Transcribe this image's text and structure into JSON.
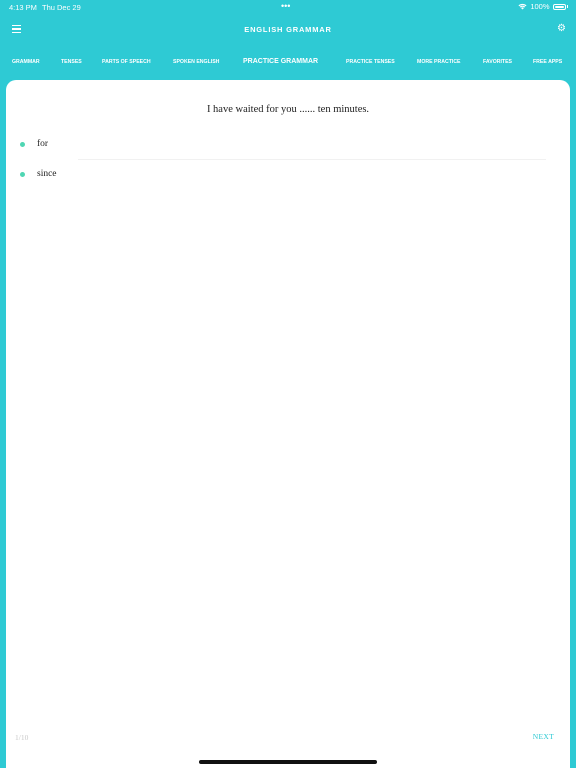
{
  "status_bar": {
    "time": "4:13 PM",
    "date": "Thu Dec 29",
    "dots": "•••",
    "battery_percent": "100%"
  },
  "nav": {
    "title": "ENGLISH GRAMMAR",
    "menu_icon": "hamburger-menu-icon",
    "settings_icon": "gear-icon"
  },
  "tabs": [
    {
      "label": "Grammar",
      "active": false
    },
    {
      "label": "Tenses",
      "active": false
    },
    {
      "label": "Parts of Speech",
      "active": false
    },
    {
      "label": "Spoken English",
      "active": false
    },
    {
      "label": "Practice Grammar",
      "active": true
    },
    {
      "label": "Practice Tenses",
      "active": false
    },
    {
      "label": "More Practice",
      "active": false
    },
    {
      "label": "Favorites",
      "active": false
    },
    {
      "label": "Free Apps",
      "active": false
    }
  ],
  "quiz": {
    "question": "I have waited for you ...... ten minutes.",
    "options": [
      "for",
      "since"
    ],
    "progress": "1/10",
    "next_label": "NEXT"
  },
  "colors": {
    "accent": "#2ecad4",
    "option_dot": "#4fd6b3"
  }
}
